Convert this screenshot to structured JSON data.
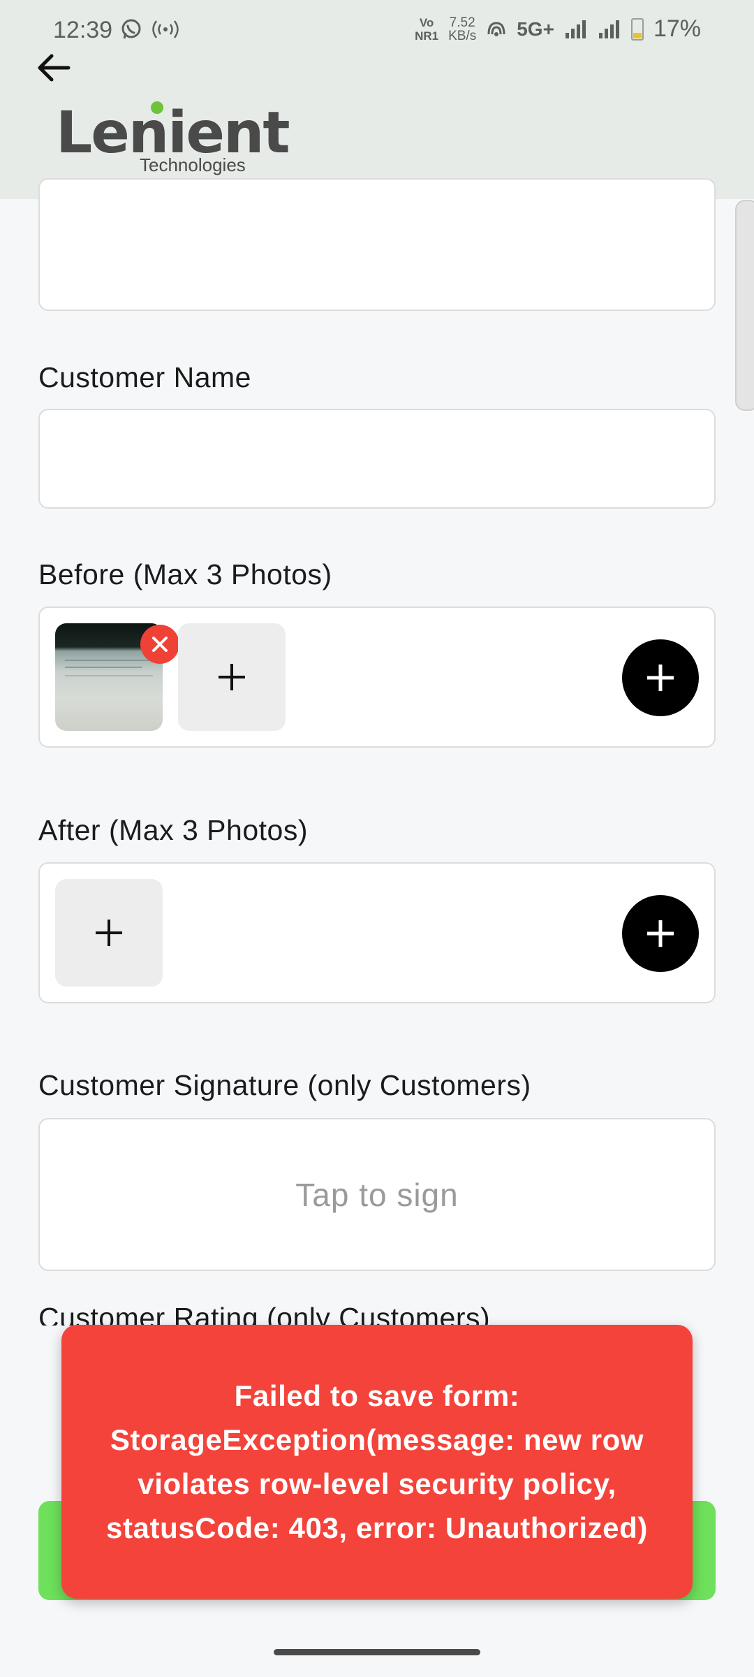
{
  "status_bar": {
    "time": "12:39",
    "volte": "Vo\nNR1",
    "net_speed": "7.52\nKB/s",
    "network_type": "5G+",
    "battery": "17%"
  },
  "header": {
    "logo_text": "Lenient",
    "logo_subtitle": "Technologies"
  },
  "form": {
    "customer_name_label": "Customer Name",
    "customer_name_value": "",
    "before_label": "Before (Max 3 Photos)",
    "after_label": "After (Max 3 Photos)",
    "signature_label": "Customer Signature (only Customers)",
    "signature_placeholder": "Tap to sign",
    "rating_label": "Customer Rating (only Customers)"
  },
  "toast": {
    "message": "Failed to save form: StorageException(message: new row violates row-level security policy, statusCode: 403, error: Unauthorized)"
  },
  "colors": {
    "header_bg": "#e6ebe8",
    "page_bg": "#f6f7f9",
    "toast_bg": "#f4433a",
    "submit_bg": "#6ee05c",
    "remove_badge": "#ef4136",
    "logo_dot": "#6dc33a"
  },
  "icons": [
    "back-arrow-icon",
    "whatsapp-icon",
    "hotspot-icon",
    "wifi-calling-icon",
    "signal-icon",
    "battery-icon",
    "close-icon",
    "plus-icon"
  ]
}
